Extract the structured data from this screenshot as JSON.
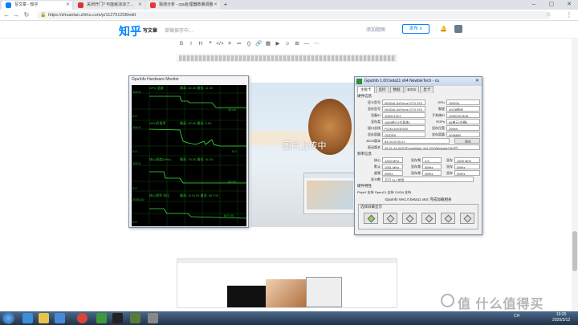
{
  "browser": {
    "tabs": [
      {
        "label": "写文章 - 知乎",
        "active": true
      },
      {
        "label": "关闭开门? 可能就凉凉了...",
        "active": false
      },
      {
        "label": "猜测分析 - cpu处理器数量调整",
        "active": false
      }
    ],
    "url": "https://zhuanlan.zhihu.com/p/112751208/edit"
  },
  "zhihu": {
    "logo": "知乎",
    "write": "写文章",
    "draft_status": "草稿保存中...",
    "cover_label": "添加题图",
    "publish_label": "发布 ∨"
  },
  "editor_toolbar": [
    "B",
    "I",
    "H",
    "❝",
    "</>",
    "≡",
    "≔",
    "{}",
    "🔗",
    "▦",
    "▶",
    "☺",
    "⊞",
    "—",
    "⋯"
  ],
  "upload_overlay": "图片上传中",
  "hardware_monitor": {
    "title": "GpuInfo Hardware Monitor",
    "graphs": [
      {
        "label": "GPU 温度",
        "min": "0.0",
        "max": "100.0",
        "reading": "最高: 52.00  最低: 11.00",
        "current": "32.00"
      },
      {
        "label": "GPU负载率",
        "min": "0.0",
        "max": "100.0",
        "reading": "最高: 82.00  最低: 0.00",
        "current": "0.0"
      },
      {
        "label": "核心速度(MHz)",
        "min": "0.0",
        "max": "100.0",
        "reading": "最高: 78.00  最低: 41.00",
        "current": "43.00"
      },
      {
        "label": "核心频率 电压",
        "min": "0.0",
        "max": "2000.00",
        "reading": "最高: 1176.00 最低: 607.00",
        "current": "607.00"
      }
    ]
  },
  "gpu_window": {
    "title": "GpuInfo 1.00 beta11 x64 NewbieTech - cu",
    "tabs": [
      "主板卡",
      "监控",
      "数据",
      "BIOS",
      "显卡"
    ],
    "section_basic": "硬件信息",
    "rows": [
      {
        "l1": "显卡型号",
        "v1": "NVIDIA GeForce GTX 970",
        "l2": "GPU",
        "v2": "GM204"
      },
      {
        "l1": "显存型号",
        "v1": "NVIDIA GeForce GTX 970",
        "l2": "制程",
        "v2": "40/28纳米"
      },
      {
        "l1": "设备ID",
        "v1": "10DE/13C2",
        "l2": "子系统ID",
        "v2": "10DE/NVIDIA"
      },
      {
        "l1": "显存类",
        "v1": "1664核心(亿晶体)",
        "l2": "ROPs",
        "v2": "56单元(光栅)"
      },
      {
        "l1": "接口总线",
        "v1": "PCIEx16(GEN3)",
        "l2": "显存位宽",
        "v2": "256bit"
      },
      {
        "l1": "显存容量",
        "v1": "GDDR5",
        "l2": "显存容量",
        "v2": "4096MB"
      }
    ],
    "bios_label": "BIOS版本",
    "bios_value": "84.04.2f.00.21",
    "bios_button": "保存",
    "driver_label": "驱动版本",
    "driver_value": "26.21.14.4120(ForceWare 441.20)/Windows7(64位)",
    "section_clock": "频率信息",
    "clock_rows": [
      {
        "l1": "核心",
        "v1": "1254 MHz",
        "l2": "显存频",
        "v2": "3.5",
        "l3": "显存",
        "v3": "1605 MHz"
      },
      {
        "l1": "默认",
        "v1": "1051 MHz",
        "l2": "显存频",
        "v2": "0MHz",
        "l3": "显存",
        "v3": "0MHz"
      },
      {
        "l1": "超频",
        "v1": "0MHz",
        "l2": "显存频",
        "v2": "0MHz",
        "l3": "显存",
        "v3": "0MHz"
      }
    ],
    "sli_label": "显卡数",
    "sli_value": "不可 SLI 禁用",
    "section_feature": "硬件特性",
    "feature_row": "PhysX    支持   OpenCL  支持   CUDA 支持",
    "footer": "GpuInfo Ver1.0 beta11 x64: 完成加载相关",
    "select_label": "选择屏幕显示"
  },
  "taskbar": {
    "time": "19:25",
    "date": "2020/3/12",
    "tray": "CH"
  },
  "watermark": "值 什么值得买"
}
